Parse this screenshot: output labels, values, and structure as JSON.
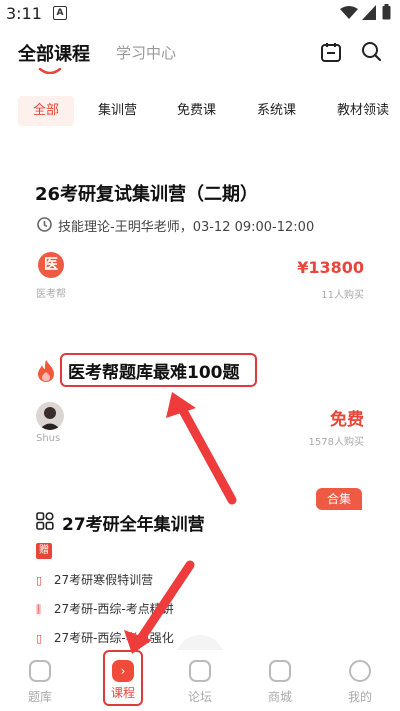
{
  "status_bar": {
    "time": "3:11",
    "notification_letter": "A"
  },
  "header": {
    "tab_active": "全部课程",
    "tab_secondary": "学习中心"
  },
  "categories": [
    "全部",
    "集训营",
    "免费课",
    "系统课",
    "教材领读"
  ],
  "course_1": {
    "title": "26考研复试集训营（二期）",
    "meta": "技能理论-王明华老师，03-12 09:00-12:00",
    "org_badge": "医",
    "org": "医考帮",
    "price": "¥13800",
    "buyers": "11人购买"
  },
  "course_2": {
    "title": "医考帮题库最难100题",
    "author": "Shus",
    "price": "免费",
    "buyers": "1578人购买"
  },
  "course_3": {
    "tag": "合集",
    "title": "27考研全年集训营",
    "gift": "赠",
    "lessons": [
      "27考研寒假特训营",
      "27考研-西综-考点精讲",
      "27考研-西综-考点强化"
    ]
  },
  "bottom_nav": {
    "items": [
      "题库",
      "课程",
      "论坛",
      "商城",
      "我的"
    ],
    "active": "课程"
  },
  "colors": {
    "accent": "#e8463a",
    "highlight_box": "#e03b3b"
  }
}
